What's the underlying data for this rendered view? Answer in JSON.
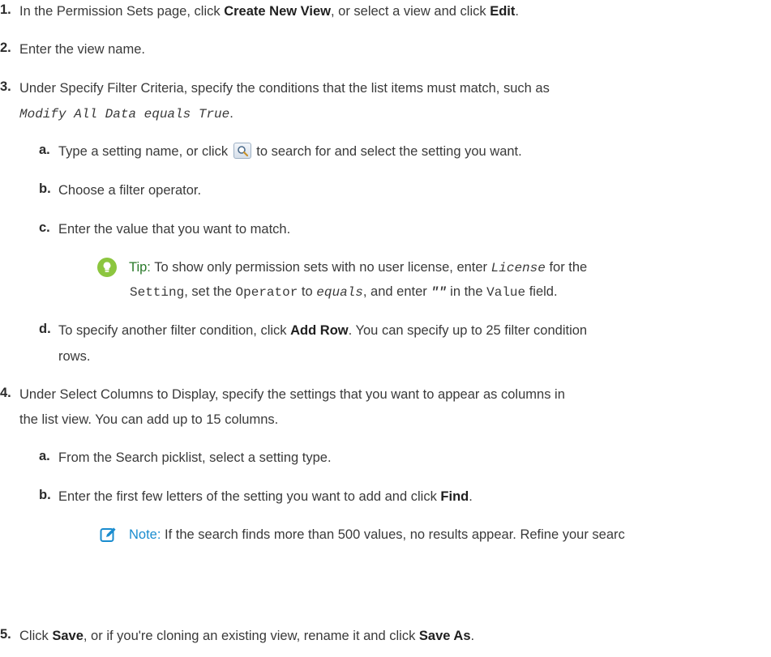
{
  "steps": {
    "s1": {
      "num": "1.",
      "pre": "In the Permission Sets page, click ",
      "b1": "Create New View",
      "mid": ", or select a view and click ",
      "b2": "Edit",
      "post": "."
    },
    "s2": {
      "num": "2.",
      "text": "Enter the view name."
    },
    "s3": {
      "num": "3.",
      "line1": "Under Specify Filter Criteria, specify the conditions that the list items must match, such as",
      "code": "Modify All Data equals True",
      "codeend": ".",
      "a": {
        "num": "a.",
        "pre": "Type a setting name, or click ",
        "post": " to search for and select the setting you want."
      },
      "b": {
        "num": "b.",
        "text": "Choose a filter operator."
      },
      "c": {
        "num": "c.",
        "text": "Enter the value that you want to match."
      },
      "tip": {
        "label": "Tip:",
        "t1": " To show only permission sets with no user license, enter ",
        "c1": "License",
        "t2": " for the",
        "c2": "Setting",
        "t3": ", set the ",
        "c3": "Operator",
        "t4": " to ",
        "c4": "equals",
        "t5": ", and enter ",
        "c5": "\"\"",
        "t6": " in the ",
        "c6": "Value",
        "t7": " field."
      },
      "d": {
        "num": "d.",
        "pre": "To specify another filter condition, click ",
        "b": "Add Row",
        "post": ". You can specify up to 25 filter condition",
        "line2": "rows."
      }
    },
    "s4": {
      "num": "4.",
      "line1": "Under Select Columns to Display, specify the settings that you want to appear as columns in",
      "line2": "the list view. You can add up to 15 columns.",
      "a": {
        "num": "a.",
        "text": "From the Search picklist, select a setting type."
      },
      "b": {
        "num": "b.",
        "pre": "Enter the first few letters of the setting you want to add and click ",
        "b": "Find",
        "post": "."
      },
      "note": {
        "label": "Note:",
        "text": " If the search finds more than 500 values, no results appear. Refine your searc"
      }
    },
    "s5": {
      "num": "5.",
      "pre": "Click ",
      "b1": "Save",
      "mid": ", or if you're cloning an existing view, rename it and click ",
      "b2": "Save As",
      "post": "."
    }
  },
  "icons": {
    "search": "magnifier-search-icon",
    "tip": "lightbulb-tip-icon",
    "note": "pencil-note-icon"
  },
  "colors": {
    "tip_icon": "#8cc63f",
    "tip_label": "#2a7a2a",
    "note_icon": "#1a8ccf",
    "text": "#3a3a3a"
  }
}
